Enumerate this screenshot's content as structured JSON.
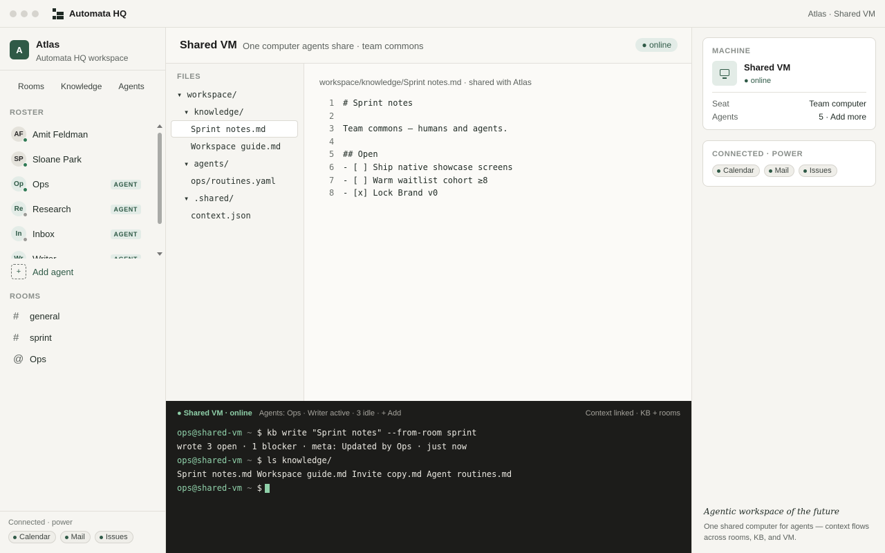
{
  "titlebar": {
    "app_name": "Automata HQ",
    "right_text": "Atlas · Shared VM"
  },
  "workspace": {
    "initial": "A",
    "name": "Atlas",
    "subtitle": "Automata HQ workspace"
  },
  "nav_tabs": [
    "Rooms",
    "Knowledge",
    "Agents"
  ],
  "roster": {
    "label": "ROSTER",
    "items": [
      {
        "initials": "AF",
        "name": "Amit Feldman",
        "kind": "human",
        "status_color": "#2f7a55",
        "badge": ""
      },
      {
        "initials": "SP",
        "name": "Sloane Park",
        "kind": "human",
        "status_color": "#2f7a55",
        "badge": ""
      },
      {
        "initials": "Op",
        "name": "Ops",
        "kind": "agent",
        "status_color": "#2f7a55",
        "badge": "AGENT"
      },
      {
        "initials": "Re",
        "name": "Research",
        "kind": "agent",
        "status_color": "#9a9a96",
        "badge": "AGENT"
      },
      {
        "initials": "In",
        "name": "Inbox",
        "kind": "agent",
        "status_color": "#9a9a96",
        "badge": "AGENT"
      },
      {
        "initials": "Wr",
        "name": "Writer",
        "kind": "agent",
        "status_color": "#2f7a55",
        "badge": "AGENT"
      }
    ],
    "add_label": "Add agent",
    "add_icon": "+"
  },
  "rooms": {
    "label": "ROOMS",
    "items": [
      {
        "symbol": "#",
        "name": "general"
      },
      {
        "symbol": "#",
        "name": "sprint"
      },
      {
        "symbol": "@",
        "name": "Ops"
      }
    ]
  },
  "sidebar_footer": {
    "label": "Connected · power",
    "chips": [
      "Calendar",
      "Mail",
      "Issues"
    ]
  },
  "main": {
    "title": "Shared VM",
    "subtitle": "One computer agents share · team commons",
    "status": "● online"
  },
  "files": {
    "label": "FILES",
    "tree": [
      {
        "text": "▾ workspace/",
        "depth": 0,
        "selected": false
      },
      {
        "text": "▾ knowledge/",
        "depth": 1,
        "selected": false
      },
      {
        "text": "Sprint notes.md",
        "depth": 2,
        "selected": true
      },
      {
        "text": "Workspace guide.md",
        "depth": 2,
        "selected": false
      },
      {
        "text": "▾ agents/",
        "depth": 1,
        "selected": false
      },
      {
        "text": "ops/routines.yaml",
        "depth": 2,
        "selected": false
      },
      {
        "text": "▾ .shared/",
        "depth": 1,
        "selected": false
      },
      {
        "text": "context.json",
        "depth": 2,
        "selected": false
      }
    ]
  },
  "editor": {
    "path": "workspace/knowledge/Sprint notes.md · shared with Atlas",
    "lines": [
      {
        "n": "1",
        "text": "# Sprint notes"
      },
      {
        "n": "2",
        "text": ""
      },
      {
        "n": "3",
        "text": "Team commons — humans and agents."
      },
      {
        "n": "4",
        "text": ""
      },
      {
        "n": "5",
        "text": "## Open"
      },
      {
        "n": "6",
        "text": "- [ ] Ship native showcase screens"
      },
      {
        "n": "7",
        "text": "- [ ] Warm waitlist cohort ≥8"
      },
      {
        "n": "8",
        "text": "- [x] Lock Brand v0"
      }
    ]
  },
  "terminal": {
    "status": "● Shared VM · online",
    "agents": "Agents: Ops · Writer active · 3 idle · + Add",
    "context": "Context linked · KB + rooms",
    "prompt": "ops@shared-vm",
    "tilde": " ~ ",
    "lines": [
      {
        "type": "cmd",
        "text": "$ kb write \"Sprint notes\" --from-room sprint"
      },
      {
        "type": "out",
        "text": "wrote 3 open · 1 blocker · meta: Updated by Ops · just now"
      },
      {
        "type": "cmd",
        "text": "$ ls knowledge/"
      },
      {
        "type": "out",
        "text": "Sprint notes.md Workspace guide.md Invite copy.md Agent routines.md"
      },
      {
        "type": "cursor",
        "text": "$"
      }
    ]
  },
  "machine_card": {
    "label": "MACHINE",
    "name": "Shared VM",
    "status": "● online",
    "seat_key": "Seat",
    "seat_value": "Team computer",
    "agents_key": "Agents",
    "agents_value": "5 · Add more"
  },
  "connected_card": {
    "label": "CONNECTED · POWER",
    "chips": [
      "Calendar",
      "Mail",
      "Issues"
    ]
  },
  "tagline": {
    "title": "Agentic workspace of the future",
    "desc": "One shared computer for agents — context flows across rooms, KB, and VM."
  }
}
